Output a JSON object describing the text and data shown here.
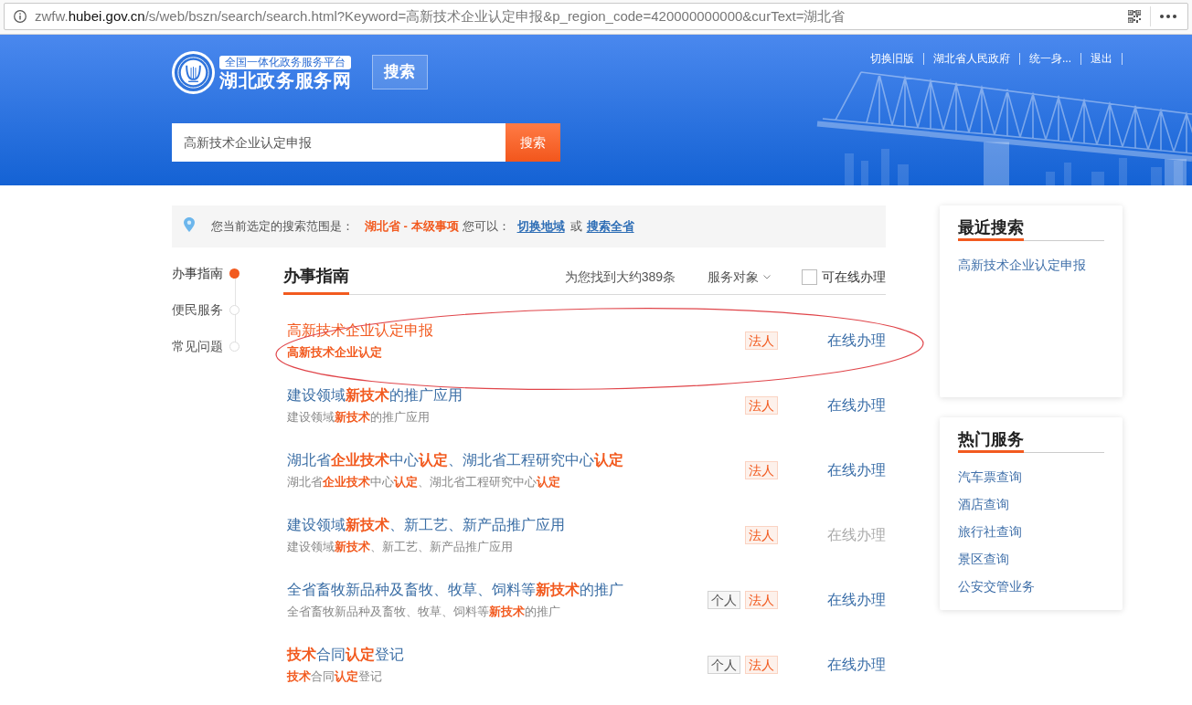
{
  "browser": {
    "url_prefix": "zwfw.",
    "url_domain": "hubei.gov.cn",
    "url_path": "/s/web/bszn/search/search.html?Keyword=高新技术企业认定申报&p_region_code=420000000000&curText=湖北省"
  },
  "header": {
    "platform_badge": "全国一体化政务服务平台",
    "site_name": "湖北政务服务网",
    "search_tab": "搜索",
    "top_links": [
      "切换旧版",
      "湖北省人民政府",
      "统一身...",
      "退出"
    ],
    "search": {
      "value": "高新技术企业认定申报",
      "button": "搜索"
    }
  },
  "scope_bar": {
    "label": "您当前选定的搜索范围是：",
    "scope": "湖北省 - 本级事项",
    "prompt": "您可以：",
    "links": [
      "切换地域",
      "搜索全省"
    ],
    "connector": "或"
  },
  "nav": [
    {
      "label": "办事指南",
      "selected": true
    },
    {
      "label": "便民服务",
      "selected": false
    },
    {
      "label": "常见问题",
      "selected": false
    }
  ],
  "results": {
    "title": "办事指南",
    "count": "为您找到大约389条",
    "filter": "服务对象",
    "online_filter": {
      "label": "可在线办理",
      "checked": false
    },
    "rows": [
      {
        "title": "高新技术企业认定申报",
        "subtitle": "高新技术企业认定",
        "highlighted": true,
        "circled": true,
        "tags": [
          {
            "label": "法人",
            "kind": "legal"
          }
        ],
        "action": {
          "label": "在线办理",
          "disabled": false
        }
      },
      {
        "title": "建设领域**新技术**的推广应用",
        "subtitle": "建设领域**新技术**的推广应用",
        "highlighted": false,
        "circled": false,
        "tags": [
          {
            "label": "法人",
            "kind": "legal"
          }
        ],
        "action": {
          "label": "在线办理",
          "disabled": false
        }
      },
      {
        "title": "湖北省**企业技术**中心**认定**、湖北省工程研究中心**认定**",
        "subtitle": "湖北省**企业技术**中心**认定**、湖北省工程研究中心**认定**",
        "highlighted": false,
        "circled": false,
        "tags": [
          {
            "label": "法人",
            "kind": "legal"
          }
        ],
        "action": {
          "label": "在线办理",
          "disabled": false
        }
      },
      {
        "title": "建设领域**新技术**、新工艺、新产品推广应用",
        "subtitle": "建设领域**新技术**、新工艺、新产品推广应用",
        "highlighted": false,
        "circled": false,
        "tags": [
          {
            "label": "法人",
            "kind": "legal"
          }
        ],
        "action": {
          "label": "在线办理",
          "disabled": true
        }
      },
      {
        "title": "全省畜牧新品种及畜牧、牧草、饲料等**新技术**的推广",
        "subtitle": "全省畜牧新品种及畜牧、牧草、饲料等**新技术**的推广",
        "highlighted": false,
        "circled": false,
        "tags": [
          {
            "label": "个人",
            "kind": "person"
          },
          {
            "label": "法人",
            "kind": "legal"
          }
        ],
        "action": {
          "label": "在线办理",
          "disabled": false
        }
      },
      {
        "title": "**技术**合同**认定**登记",
        "subtitle": "**技术**合同**认定**登记",
        "highlighted": false,
        "circled": false,
        "tags": [
          {
            "label": "个人",
            "kind": "person"
          },
          {
            "label": "法人",
            "kind": "legal"
          }
        ],
        "action": {
          "label": "在线办理",
          "disabled": false
        }
      }
    ]
  },
  "recent_searches": {
    "title": "最近搜索",
    "items": [
      "高新技术企业认定申报"
    ]
  },
  "hot_services": {
    "title": "热门服务",
    "items": [
      "汽车票查询",
      "酒店查询",
      "旅行社查询",
      "景区查询",
      "公安交管业务"
    ]
  }
}
